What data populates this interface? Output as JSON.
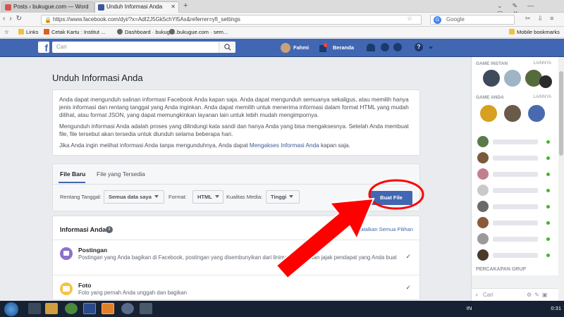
{
  "browser": {
    "tabs": [
      {
        "label": "Posts ‹ bukugue.com — Word",
        "active": false
      },
      {
        "label": "Unduh Informasi Anda",
        "active": true
      }
    ],
    "new_tab": "+",
    "url": "https://www.facebook.com/dyi/?x=AdI2J5Gk5chYl5Ax&referrer=yfi_settings",
    "search_engine": "Google",
    "bookmarks": [
      "Links",
      "Cetak Kartu : Institut ...",
      "Dashboard · bukugu...",
      "bukugue.com · sem..."
    ],
    "mobile_bookmarks": "Mobile bookmarks"
  },
  "fb_header": {
    "logo": "f",
    "search_placeholder": "Cari",
    "user_name": "Fahmi",
    "home": "Beranda"
  },
  "page": {
    "title": "Unduh Informasi Anda",
    "intro": {
      "p1": "Anda dapat mengunduh salinan informasi Facebook Anda kapan saja. Anda dapat mengunduh semuanya sekaligus, atau memilih hanya jenis informasi dan rentang tanggal yang Anda inginkan. Anda dapat memilih untuk menerima informasi dalam format HTML yang mudah dilihat, atau format JSON, yang dapat memungkinkan layanan lain untuk lebih mudah mengimpornya.",
      "p2": "Mengunduh informasi Anda adalah proses yang dilindungi kata sandi dan hanya Anda yang bisa mengaksesnya. Setelah Anda membuat file, file tersebut akan tersedia untuk diunduh selama beberapa hari.",
      "p3_before": "Jika Anda ingin melihat informasi Anda tanpa mengunduhnya, Anda dapat ",
      "p3_link": "Mengakses Informasi Anda",
      "p3_after": " kapan saja."
    },
    "tabs": {
      "new_file": "File Baru",
      "available": "File yang Tersedia"
    },
    "options": {
      "date_range_label": "Rentang Tanggal:",
      "date_range_value": "Semua data saya",
      "format_label": "Format:",
      "format_value": "HTML",
      "media_quality_label": "Kualitas Media:",
      "media_quality_value": "Tinggi"
    },
    "create_button": "Buat File",
    "info": {
      "header": "Informasi Anda",
      "info_icon": "i",
      "deselect_all": "Batalkan Semua Pilihan",
      "items": [
        {
          "title": "Postingan",
          "desc": "Postingan yang Anda bagikan di Facebook, postingan yang disembunyikan dari linimasa Anda, dan jajak pendapat yang Anda buat",
          "checked": true
        },
        {
          "title": "Foto",
          "desc": "Foto yang pernah Anda unggah dan bagikan",
          "checked": true
        }
      ]
    }
  },
  "sidebar": {
    "game_instan": "GAME INSTAN",
    "game_anda": "GAME ANDA",
    "lainnya": "LAINNYA",
    "group_chat": "PERCAKAPAN GRUP",
    "search_placeholder": "Cari"
  },
  "taskbar": {
    "lang": "IN",
    "time": "0:31"
  },
  "colors": {
    "fb_blue": "#4267b2",
    "annotation_red": "#ff0000"
  }
}
